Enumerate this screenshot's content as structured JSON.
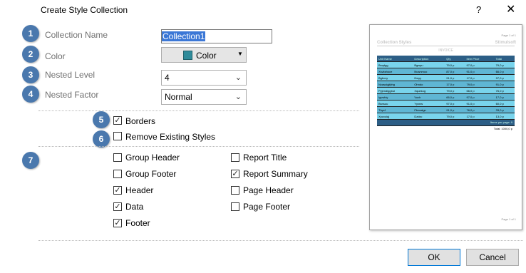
{
  "window": {
    "title": "Create Style Collection",
    "help_label": "?",
    "close_label": "✕"
  },
  "form": {
    "collection_name_label": "Collection Name",
    "collection_name_value": "Collection1",
    "color_label": "Color",
    "color_value": "Color",
    "color_swatch": "#2f8b9a",
    "nested_level_label": "Nested Level",
    "nested_level_value": "4",
    "nested_factor_label": "Nested Factor",
    "nested_factor_value": "Normal"
  },
  "badges": [
    "1",
    "2",
    "3",
    "4",
    "5",
    "6",
    "7"
  ],
  "options": {
    "borders": {
      "label": "Borders",
      "checked": true
    },
    "remove_styles": {
      "label": "Remove Existing Styles",
      "checked": false
    }
  },
  "components": {
    "left": [
      {
        "label": "Group Header",
        "checked": false
      },
      {
        "label": "Group Footer",
        "checked": false
      },
      {
        "label": "Header",
        "checked": true
      },
      {
        "label": "Data",
        "checked": true
      },
      {
        "label": "Footer",
        "checked": true
      }
    ],
    "right": [
      {
        "label": "Report Title",
        "checked": false
      },
      {
        "label": "Report Summary",
        "checked": true
      },
      {
        "label": "Page Header",
        "checked": false
      },
      {
        "label": "Page Footer",
        "checked": false
      }
    ]
  },
  "preview": {
    "page_top": "Page 1 of 1",
    "left_title": "Collection Styles",
    "right_title": "Stimulsoft",
    "invoice": "INVOICE",
    "headers": [
      "Unit Name",
      "Description",
      "Qty",
      "Item Price",
      "Total"
    ],
    "rows": [
      [
        "Bsqdgg",
        "Bgwpu",
        "79,0 p",
        "97,0 p",
        "79,0 p"
      ],
      [
        "Xsvkshoce",
        "Nuwnmoo",
        "87,0 p",
        "91,0 p",
        "66,0 p"
      ],
      [
        "Bgbvvy",
        "Dwyy",
        "91,0 p",
        "17,0 p",
        "97,0 p"
      ],
      [
        "Ncasuigjfyhg",
        "Ohndo",
        "17,0 p",
        "79,0 p",
        "91,0 p"
      ],
      [
        "Pyjendiggbui",
        "Xquekog",
        "79,0 p",
        "66,0 p",
        "76,0 p"
      ],
      [
        "Igvwhiy",
        "Vuvh",
        "66,0 p",
        "97,0 p",
        "17,0 p"
      ],
      [
        "Bsnsuu",
        "Yyxnw",
        "97,0 p",
        "91,0 p",
        "60,0 p"
      ],
      [
        "Thyxf",
        "Fbxoaign",
        "91,0 p",
        "76,0 p",
        "33,0 p"
      ],
      [
        "Xpcxciqj",
        "Dzdxc",
        "79,0 p",
        "17,0 p",
        "13,0 p"
      ]
    ],
    "items_per_page": "Items per page: 9",
    "total": "Total: 1000,0 p",
    "page_bottom": "Page 1 of 1"
  },
  "buttons": {
    "ok": "OK",
    "cancel": "Cancel"
  }
}
